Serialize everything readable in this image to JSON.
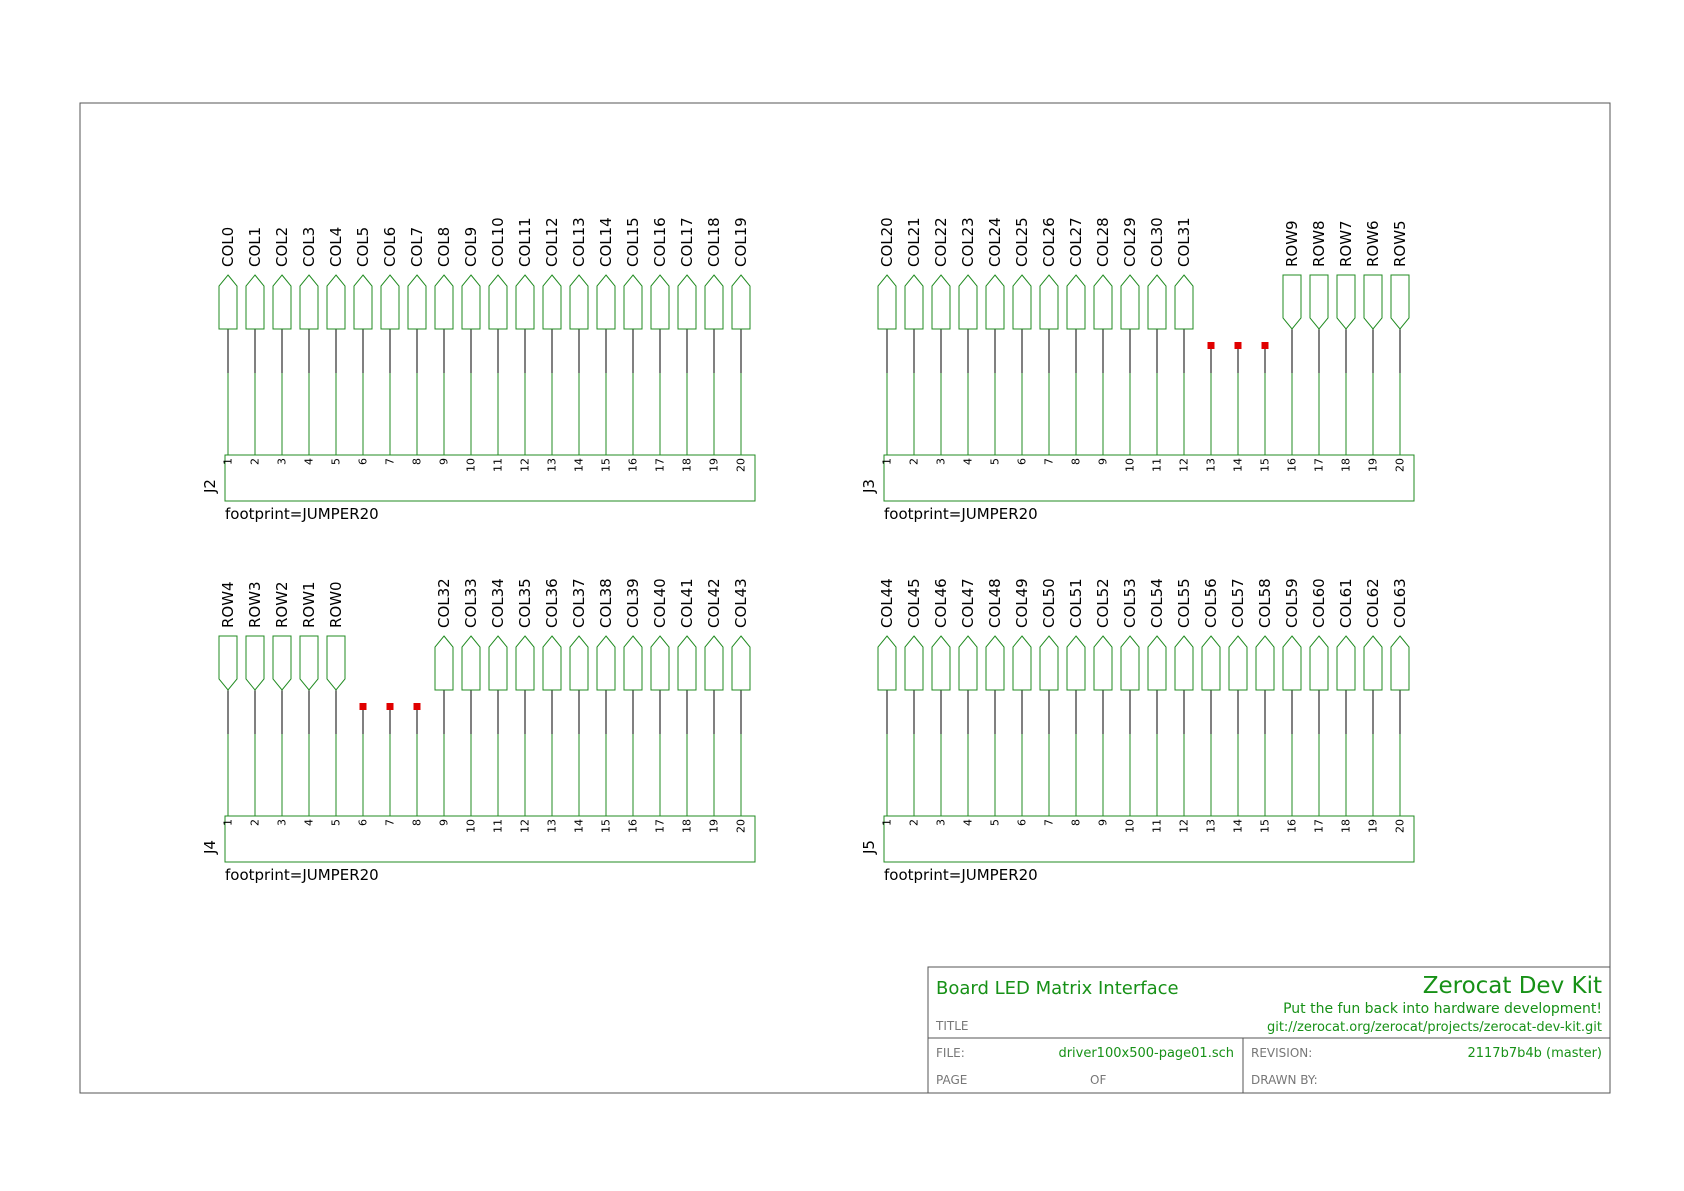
{
  "colors": {
    "wire": "#208b20",
    "pin": "#000000",
    "noconnect": "#e00000",
    "border": "#555555",
    "title_green": "#179117",
    "title_gray": "#777777"
  },
  "connectors": [
    {
      "ref": "J2",
      "footprint": "footprint=JUMPER20",
      "pin_numbers": [
        "1",
        "2",
        "3",
        "4",
        "5",
        "6",
        "7",
        "8",
        "9",
        "10",
        "11",
        "12",
        "13",
        "14",
        "15",
        "16",
        "17",
        "18",
        "19",
        "20"
      ],
      "nets": [
        {
          "name": "COL0",
          "dir": "out"
        },
        {
          "name": "COL1",
          "dir": "out"
        },
        {
          "name": "COL2",
          "dir": "out"
        },
        {
          "name": "COL3",
          "dir": "out"
        },
        {
          "name": "COL4",
          "dir": "out"
        },
        {
          "name": "COL5",
          "dir": "out"
        },
        {
          "name": "COL6",
          "dir": "out"
        },
        {
          "name": "COL7",
          "dir": "out"
        },
        {
          "name": "COL8",
          "dir": "out"
        },
        {
          "name": "COL9",
          "dir": "out"
        },
        {
          "name": "COL10",
          "dir": "out"
        },
        {
          "name": "COL11",
          "dir": "out"
        },
        {
          "name": "COL12",
          "dir": "out"
        },
        {
          "name": "COL13",
          "dir": "out"
        },
        {
          "name": "COL14",
          "dir": "out"
        },
        {
          "name": "COL15",
          "dir": "out"
        },
        {
          "name": "COL16",
          "dir": "out"
        },
        {
          "name": "COL17",
          "dir": "out"
        },
        {
          "name": "COL18",
          "dir": "out"
        },
        {
          "name": "COL19",
          "dir": "out"
        }
      ]
    },
    {
      "ref": "J3",
      "footprint": "footprint=JUMPER20",
      "pin_numbers": [
        "1",
        "2",
        "3",
        "4",
        "5",
        "6",
        "7",
        "8",
        "9",
        "10",
        "11",
        "12",
        "13",
        "14",
        "15",
        "16",
        "17",
        "18",
        "19",
        "20"
      ],
      "nets": [
        {
          "name": "COL20",
          "dir": "out"
        },
        {
          "name": "COL21",
          "dir": "out"
        },
        {
          "name": "COL22",
          "dir": "out"
        },
        {
          "name": "COL23",
          "dir": "out"
        },
        {
          "name": "COL24",
          "dir": "out"
        },
        {
          "name": "COL25",
          "dir": "out"
        },
        {
          "name": "COL26",
          "dir": "out"
        },
        {
          "name": "COL27",
          "dir": "out"
        },
        {
          "name": "COL28",
          "dir": "out"
        },
        {
          "name": "COL29",
          "dir": "out"
        },
        {
          "name": "COL30",
          "dir": "out"
        },
        {
          "name": "COL31",
          "dir": "out"
        },
        {
          "name": "",
          "dir": "nc"
        },
        {
          "name": "",
          "dir": "nc"
        },
        {
          "name": "",
          "dir": "nc"
        },
        {
          "name": "ROW9",
          "dir": "in"
        },
        {
          "name": "ROW8",
          "dir": "in"
        },
        {
          "name": "ROW7",
          "dir": "in"
        },
        {
          "name": "ROW6",
          "dir": "in"
        },
        {
          "name": "ROW5",
          "dir": "in"
        }
      ]
    },
    {
      "ref": "J4",
      "footprint": "footprint=JUMPER20",
      "pin_numbers": [
        "1",
        "2",
        "3",
        "4",
        "5",
        "6",
        "7",
        "8",
        "9",
        "10",
        "11",
        "12",
        "13",
        "14",
        "15",
        "16",
        "17",
        "18",
        "19",
        "20"
      ],
      "nets": [
        {
          "name": "ROW4",
          "dir": "in"
        },
        {
          "name": "ROW3",
          "dir": "in"
        },
        {
          "name": "ROW2",
          "dir": "in"
        },
        {
          "name": "ROW1",
          "dir": "in"
        },
        {
          "name": "ROW0",
          "dir": "in"
        },
        {
          "name": "",
          "dir": "nc"
        },
        {
          "name": "",
          "dir": "nc"
        },
        {
          "name": "",
          "dir": "nc"
        },
        {
          "name": "COL32",
          "dir": "out"
        },
        {
          "name": "COL33",
          "dir": "out"
        },
        {
          "name": "COL34",
          "dir": "out"
        },
        {
          "name": "COL35",
          "dir": "out"
        },
        {
          "name": "COL36",
          "dir": "out"
        },
        {
          "name": "COL37",
          "dir": "out"
        },
        {
          "name": "COL38",
          "dir": "out"
        },
        {
          "name": "COL39",
          "dir": "out"
        },
        {
          "name": "COL40",
          "dir": "out"
        },
        {
          "name": "COL41",
          "dir": "out"
        },
        {
          "name": "COL42",
          "dir": "out"
        },
        {
          "name": "COL43",
          "dir": "out"
        }
      ]
    },
    {
      "ref": "J5",
      "footprint": "footprint=JUMPER20",
      "pin_numbers": [
        "1",
        "2",
        "3",
        "4",
        "5",
        "6",
        "7",
        "8",
        "9",
        "10",
        "11",
        "12",
        "13",
        "14",
        "15",
        "16",
        "17",
        "18",
        "19",
        "20"
      ],
      "nets": [
        {
          "name": "COL44",
          "dir": "out"
        },
        {
          "name": "COL45",
          "dir": "out"
        },
        {
          "name": "COL46",
          "dir": "out"
        },
        {
          "name": "COL47",
          "dir": "out"
        },
        {
          "name": "COL48",
          "dir": "out"
        },
        {
          "name": "COL49",
          "dir": "out"
        },
        {
          "name": "COL50",
          "dir": "out"
        },
        {
          "name": "COL51",
          "dir": "out"
        },
        {
          "name": "COL52",
          "dir": "out"
        },
        {
          "name": "COL53",
          "dir": "out"
        },
        {
          "name": "COL54",
          "dir": "out"
        },
        {
          "name": "COL55",
          "dir": "out"
        },
        {
          "name": "COL56",
          "dir": "out"
        },
        {
          "name": "COL57",
          "dir": "out"
        },
        {
          "name": "COL58",
          "dir": "out"
        },
        {
          "name": "COL59",
          "dir": "out"
        },
        {
          "name": "COL60",
          "dir": "out"
        },
        {
          "name": "COL61",
          "dir": "out"
        },
        {
          "name": "COL62",
          "dir": "out"
        },
        {
          "name": "COL63",
          "dir": "out"
        }
      ]
    }
  ],
  "title_block": {
    "title": "Board LED Matrix Interface",
    "title_label": "TITLE",
    "company": "Zerocat Dev Kit",
    "tagline": "Put the fun back into hardware development!",
    "repo": "git://zerocat.org/zerocat/projects/zerocat-dev-kit.git",
    "file_label": "FILE:",
    "file_value": "driver100x500-page01.sch",
    "revision_label": "REVISION:",
    "revision_value": "2117b7b4b (master)",
    "page_label": "PAGE",
    "of_label": "OF",
    "drawn_by_label": "DRAWN BY:"
  }
}
